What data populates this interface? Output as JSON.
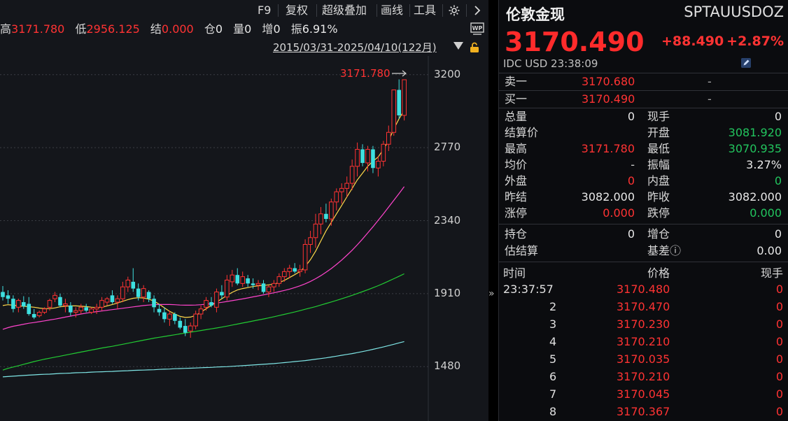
{
  "toolbar": {
    "items": [
      "F9",
      "复权",
      "超级叠加",
      "画线",
      "工具"
    ],
    "settings_icon": "gear-icon",
    "next_icon": "chevron-right-icon"
  },
  "stats": {
    "high_label": "高",
    "high_value": "3171.780",
    "low_label": "低",
    "low_value": "2956.125",
    "settle_label": "结",
    "settle_value": "0.000",
    "pos_label": "仓",
    "pos_value": "0",
    "vol_label": "量",
    "vol_value": "0",
    "inc_label": "增",
    "inc_value": "0",
    "amp_label": "振",
    "amp_value": "6.91%"
  },
  "range": "2015/03/31-2025/04/10(122月)",
  "chart_data": {
    "type": "candlestick",
    "y_ticks": [
      "3200",
      "2770",
      "2340",
      "1910",
      "1480"
    ],
    "ylim": [
      1160,
      3310
    ],
    "max_annotation": "3171.780",
    "candles_ohlc": [
      [
        1920,
        1955,
        1870,
        1890
      ],
      [
        1900,
        1930,
        1850,
        1880
      ],
      [
        1880,
        1900,
        1800,
        1820
      ],
      [
        1830,
        1880,
        1800,
        1870
      ],
      [
        1860,
        1895,
        1820,
        1835
      ],
      [
        1850,
        1890,
        1780,
        1790
      ],
      [
        1790,
        1820,
        1760,
        1770
      ],
      [
        1780,
        1810,
        1770,
        1800
      ],
      [
        1800,
        1830,
        1790,
        1820
      ],
      [
        1830,
        1880,
        1810,
        1870
      ],
      [
        1880,
        1920,
        1860,
        1900
      ],
      [
        1890,
        1910,
        1830,
        1840
      ],
      [
        1840,
        1880,
        1800,
        1850
      ],
      [
        1840,
        1860,
        1780,
        1800
      ],
      [
        1800,
        1830,
        1770,
        1810
      ],
      [
        1810,
        1850,
        1790,
        1830
      ],
      [
        1830,
        1850,
        1800,
        1810
      ],
      [
        1800,
        1830,
        1790,
        1820
      ],
      [
        1820,
        1850,
        1790,
        1830
      ],
      [
        1830,
        1890,
        1810,
        1870
      ],
      [
        1860,
        1890,
        1840,
        1880
      ],
      [
        1900,
        1930,
        1850,
        1860
      ],
      [
        1860,
        1900,
        1820,
        1880
      ],
      [
        1880,
        1980,
        1860,
        1950
      ],
      [
        1950,
        2010,
        1920,
        1990
      ],
      [
        1980,
        2060,
        1920,
        1940
      ],
      [
        1940,
        1970,
        1870,
        1890
      ],
      [
        1890,
        1960,
        1860,
        1940
      ],
      [
        1920,
        1930,
        1860,
        1880
      ],
      [
        1880,
        1900,
        1800,
        1830
      ],
      [
        1820,
        1850,
        1780,
        1800
      ],
      [
        1800,
        1830,
        1740,
        1760
      ],
      [
        1760,
        1810,
        1720,
        1790
      ],
      [
        1790,
        1800,
        1730,
        1750
      ],
      [
        1750,
        1770,
        1700,
        1710
      ],
      [
        1720,
        1760,
        1660,
        1680
      ],
      [
        1690,
        1740,
        1650,
        1720
      ],
      [
        1720,
        1810,
        1700,
        1790
      ],
      [
        1790,
        1840,
        1760,
        1820
      ],
      [
        1830,
        1890,
        1810,
        1870
      ],
      [
        1860,
        1890,
        1830,
        1840
      ],
      [
        1830,
        1940,
        1800,
        1920
      ],
      [
        1920,
        1960,
        1880,
        1900
      ],
      [
        1890,
        2020,
        1870,
        1990
      ],
      [
        1980,
        2050,
        1950,
        2020
      ],
      [
        2020,
        2060,
        1960,
        1970
      ],
      [
        1970,
        2040,
        1950,
        2010
      ],
      [
        2000,
        2020,
        1950,
        1970
      ],
      [
        1970,
        2000,
        1940,
        1960
      ],
      [
        1960,
        1990,
        1930,
        1970
      ],
      [
        1970,
        1990,
        1910,
        1920
      ],
      [
        1920,
        1960,
        1890,
        1950
      ],
      [
        1950,
        1990,
        1920,
        1970
      ],
      [
        1970,
        2030,
        1950,
        2010
      ],
      [
        2010,
        2060,
        1980,
        2040
      ],
      [
        2040,
        2080,
        2000,
        2060
      ],
      [
        2060,
        2090,
        2030,
        2040
      ],
      [
        2040,
        2080,
        2010,
        2050
      ],
      [
        2050,
        2230,
        2030,
        2200
      ],
      [
        2200,
        2280,
        2150,
        2240
      ],
      [
        2240,
        2380,
        2180,
        2320
      ],
      [
        2320,
        2420,
        2260,
        2380
      ],
      [
        2380,
        2440,
        2330,
        2350
      ],
      [
        2350,
        2470,
        2310,
        2450
      ],
      [
        2450,
        2530,
        2400,
        2510
      ],
      [
        2510,
        2560,
        2440,
        2530
      ],
      [
        2530,
        2600,
        2480,
        2560
      ],
      [
        2560,
        2700,
        2520,
        2660
      ],
      [
        2660,
        2800,
        2600,
        2760
      ],
      [
        2760,
        2790,
        2660,
        2680
      ],
      [
        2680,
        2780,
        2630,
        2760
      ],
      [
        2760,
        2780,
        2620,
        2650
      ],
      [
        2650,
        2720,
        2600,
        2690
      ],
      [
        2690,
        2810,
        2660,
        2790
      ],
      [
        2790,
        2900,
        2750,
        2860
      ],
      [
        2860,
        3110,
        2840,
        3110
      ],
      [
        3110,
        3172,
        2940,
        2960
      ],
      [
        2960,
        3172,
        2930,
        3170
      ]
    ],
    "ma_series": [
      {
        "color": "#ffd84a",
        "values": [
          1840,
          1845,
          1842,
          1838,
          1836,
          1833,
          1830,
          1825,
          1822,
          1822,
          1826,
          1833,
          1836,
          1838,
          1838,
          1836,
          1834,
          1830,
          1828,
          1830,
          1838,
          1846,
          1855,
          1865,
          1875,
          1883,
          1886,
          1884,
          1878,
          1866,
          1848,
          1826,
          1806,
          1790,
          1776,
          1770,
          1772,
          1782,
          1800,
          1822,
          1840,
          1860,
          1880,
          1900,
          1918,
          1932,
          1940,
          1946,
          1952,
          1956,
          1958,
          1962,
          1966,
          1975,
          1988,
          2005,
          2022,
          2040,
          2070,
          2110,
          2160,
          2220,
          2280,
          2330,
          2380,
          2430,
          2480,
          2530,
          2580,
          2620,
          2660,
          2690,
          2715,
          2760,
          2810,
          2880,
          2940,
          2990
        ]
      },
      {
        "color": "#ff44cc",
        "values": [
          1700,
          1710,
          1718,
          1724,
          1730,
          1736,
          1740,
          1745,
          1750,
          1755,
          1760,
          1766,
          1772,
          1778,
          1784,
          1790,
          1795,
          1800,
          1804,
          1808,
          1812,
          1816,
          1820,
          1824,
          1828,
          1832,
          1836,
          1840,
          1843,
          1845,
          1846,
          1846,
          1846,
          1845,
          1843,
          1842,
          1842,
          1843,
          1845,
          1848,
          1851,
          1855,
          1859,
          1864,
          1869,
          1874,
          1879,
          1885,
          1891,
          1897,
          1903,
          1909,
          1915,
          1922,
          1929,
          1937,
          1946,
          1956,
          1968,
          1982,
          1998,
          2016,
          2036,
          2058,
          2082,
          2108,
          2136,
          2166,
          2198,
          2232,
          2268,
          2304,
          2342,
          2380,
          2420,
          2460,
          2500,
          2540
        ]
      },
      {
        "color": "#22cc33",
        "values": [
          1460,
          1470,
          1478,
          1486,
          1494,
          1502,
          1510,
          1517,
          1524,
          1530,
          1536,
          1542,
          1548,
          1554,
          1560,
          1566,
          1572,
          1578,
          1584,
          1590,
          1595,
          1600,
          1606,
          1612,
          1618,
          1624,
          1630,
          1636,
          1642,
          1648,
          1653,
          1658,
          1663,
          1668,
          1673,
          1678,
          1683,
          1688,
          1693,
          1698,
          1703,
          1708,
          1713,
          1719,
          1725,
          1731,
          1737,
          1743,
          1749,
          1755,
          1761,
          1767,
          1774,
          1781,
          1788,
          1795,
          1802,
          1810,
          1818,
          1826,
          1834,
          1843,
          1852,
          1861,
          1870,
          1880,
          1890,
          1900,
          1911,
          1922,
          1933,
          1945,
          1957,
          1970,
          1984,
          1998,
          2012,
          2027
        ]
      },
      {
        "color": "#7fe6e6",
        "values": [
          1420,
          1422,
          1424,
          1426,
          1428,
          1430,
          1432,
          1434,
          1435,
          1436,
          1438,
          1440,
          1441,
          1442,
          1444,
          1445,
          1446,
          1448,
          1449,
          1450,
          1451,
          1452,
          1454,
          1455,
          1456,
          1458,
          1459,
          1460,
          1461,
          1462,
          1464,
          1465,
          1466,
          1468,
          1469,
          1470,
          1471,
          1472,
          1474,
          1475,
          1476,
          1478,
          1479,
          1480,
          1482,
          1484,
          1486,
          1488,
          1490,
          1492,
          1494,
          1496,
          1498,
          1501,
          1504,
          1507,
          1510,
          1513,
          1516,
          1520,
          1524,
          1528,
          1532,
          1537,
          1542,
          1547,
          1552,
          1557,
          1563,
          1569,
          1575,
          1582,
          1589,
          1596,
          1604,
          1612,
          1620,
          1628
        ]
      }
    ],
    "up_color": "#ff3333",
    "down_color": "#3ee0e0"
  },
  "quote": {
    "name": "伦敦金现",
    "code": "SPTAUUSDOZ",
    "price": "3170.490",
    "change": "+88.490",
    "change_pct": "+2.87%",
    "source": "IDC  USD  23:38:09",
    "orderbook": [
      {
        "label": "卖一",
        "price": "3170.680",
        "vol": "-"
      },
      {
        "label": "买一",
        "price": "3170.490",
        "vol": "-"
      }
    ],
    "grid": [
      {
        "l": "总量",
        "lv": "0",
        "lc": "white",
        "r": "现手",
        "rv": "0",
        "rc": "white"
      },
      {
        "l": "结算价",
        "lv": "",
        "lc": "white",
        "r": "开盘",
        "rv": "3081.920",
        "rc": "green"
      },
      {
        "l": "最高",
        "lv": "3171.780",
        "lc": "red",
        "r": "最低",
        "rv": "3070.935",
        "rc": "green"
      },
      {
        "l": "均价",
        "lv": "-",
        "lc": "grey",
        "r": "振幅",
        "rv": "3.27%",
        "rc": "white"
      },
      {
        "l": "外盘",
        "lv": "0",
        "lc": "red",
        "r": "内盘",
        "rv": "0",
        "rc": "green"
      },
      {
        "l": "昨结",
        "lv": "3082.000",
        "lc": "white",
        "r": "昨收",
        "rv": "3082.000",
        "rc": "white"
      },
      {
        "l": "涨停",
        "lv": "0.000",
        "lc": "red",
        "r": "跌停",
        "rv": "0.000",
        "rc": "green"
      }
    ],
    "grid2": [
      {
        "l": "持仓",
        "lv": "0",
        "lc": "white",
        "r": "增仓",
        "rv": "0",
        "rc": "white"
      },
      {
        "l": "估结算",
        "lv": "",
        "lc": "white",
        "r": "基差ⓘ",
        "rv": "0.00",
        "rc": "white"
      }
    ],
    "ticks_header": {
      "time": "时间",
      "price": "价格",
      "vol": "现手"
    },
    "ticks": [
      {
        "time": "23:37:57",
        "price": "3170.480",
        "vol": "0"
      },
      {
        "time": "2",
        "price": "3170.470",
        "vol": "0"
      },
      {
        "time": "3",
        "price": "3170.230",
        "vol": "0"
      },
      {
        "time": "4",
        "price": "3170.210",
        "vol": "0"
      },
      {
        "time": "5",
        "price": "3170.035",
        "vol": "0"
      },
      {
        "time": "6",
        "price": "3170.210",
        "vol": "0"
      },
      {
        "time": "7",
        "price": "3170.045",
        "vol": "0"
      },
      {
        "time": "8",
        "price": "3170.367",
        "vol": "0"
      }
    ]
  }
}
